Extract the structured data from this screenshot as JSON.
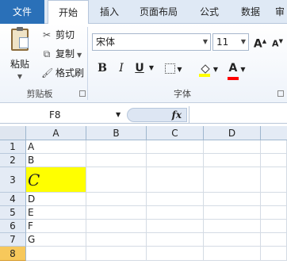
{
  "tabs": {
    "file": "文件",
    "home": "开始",
    "insert": "插入",
    "layout": "页面布局",
    "formulas": "公式",
    "data": "数据",
    "more": "审"
  },
  "clipboard": {
    "paste_label": "粘贴",
    "cut_label": "剪切",
    "copy_label": "复制",
    "painter_label": "格式刷",
    "group_label": "剪贴板"
  },
  "font": {
    "font_name": "宋体",
    "font_size": "11",
    "grow": "A",
    "shrink": "A",
    "bold": "B",
    "italic": "I",
    "underline": "U",
    "font_color_letter": "A",
    "group_label": "字体",
    "highlight_color": "#ffff00",
    "font_color": "#ff0000"
  },
  "formula_bar": {
    "name_box": "F8",
    "fx": "fx",
    "value": ""
  },
  "sheet": {
    "columns": [
      "A",
      "B",
      "C",
      "D"
    ],
    "rows": [
      {
        "num": "1",
        "a": "A"
      },
      {
        "num": "2",
        "a": "B"
      },
      {
        "num": "3",
        "a": "C"
      },
      {
        "num": "4",
        "a": "D"
      },
      {
        "num": "5",
        "a": "E"
      },
      {
        "num": "6",
        "a": "F"
      },
      {
        "num": "7",
        "a": "G"
      },
      {
        "num": "8",
        "a": ""
      }
    ],
    "highlight_cell": "A3",
    "selected_row": "8"
  }
}
